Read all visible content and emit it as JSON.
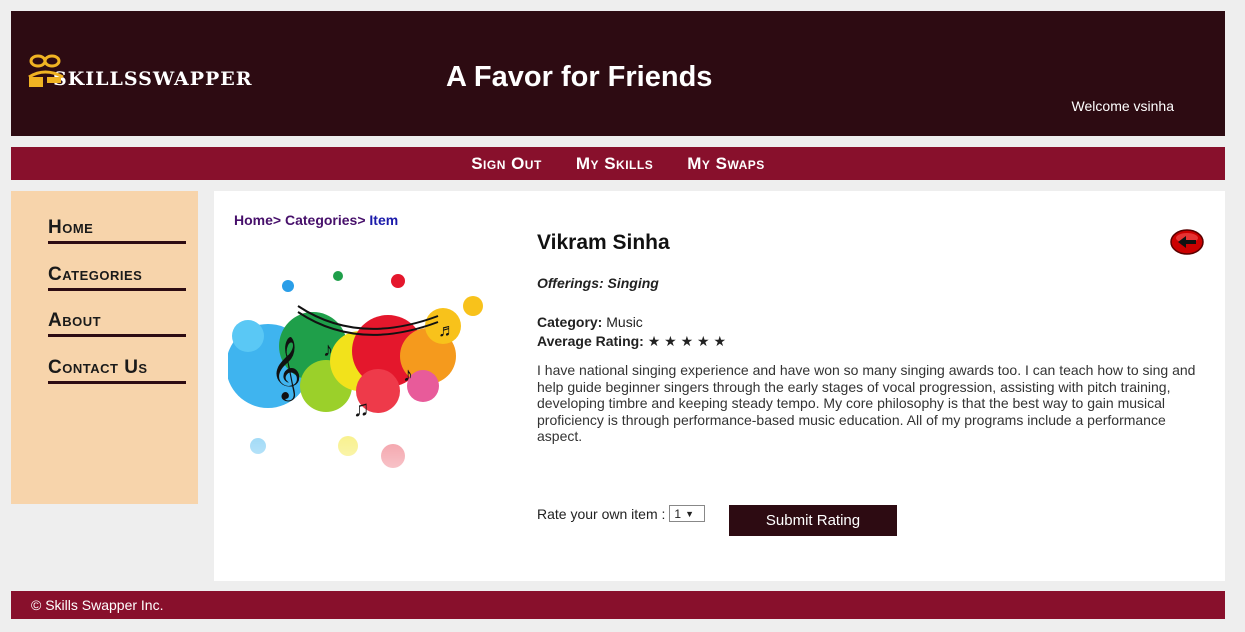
{
  "header": {
    "logo_text": "SKILLSSWAPPER",
    "title": "A Favor for Friends",
    "welcome": "Welcome vsinha"
  },
  "topnav": {
    "items": [
      "Sign Out",
      "My Skills",
      "My Swaps"
    ]
  },
  "sidebar": {
    "items": [
      "Home",
      "Categories",
      "About",
      "Contact Us"
    ]
  },
  "breadcrumb": {
    "home": "Home>",
    "categories": "Categories>",
    "item": "Item"
  },
  "item": {
    "name": "Vikram Sinha",
    "offerings": "Offerings: Singing",
    "category_label": "Category:",
    "category_value": "Music",
    "rating_label": "Average Rating:",
    "rating_stars": "★ ★ ★ ★ ★",
    "description": "I have national singing experience and have won so many singing awards too. I can teach how to sing and help guide beginner singers through the early stages of vocal progression, assisting with pitch training, developing timbre and keeping steady tempo. My core philosophy is that the best way to gain musical proficiency is through performance-based music education. All of my programs include a performance aspect."
  },
  "rate": {
    "label": "Rate your own item :",
    "selected": "1",
    "button": "Submit Rating"
  },
  "footer": {
    "text": "© Skills Swapper Inc."
  },
  "colors": {
    "header_bg": "#2d0b12",
    "nav_bg": "#88102c",
    "sidebar_bg": "#f7d4ab",
    "logo_gold": "#f0b323",
    "back_red": "#cc0000"
  },
  "icons": {
    "logo": "people-group-icon",
    "back": "back-arrow-icon",
    "select_arrow": "dropdown-arrow-icon"
  }
}
